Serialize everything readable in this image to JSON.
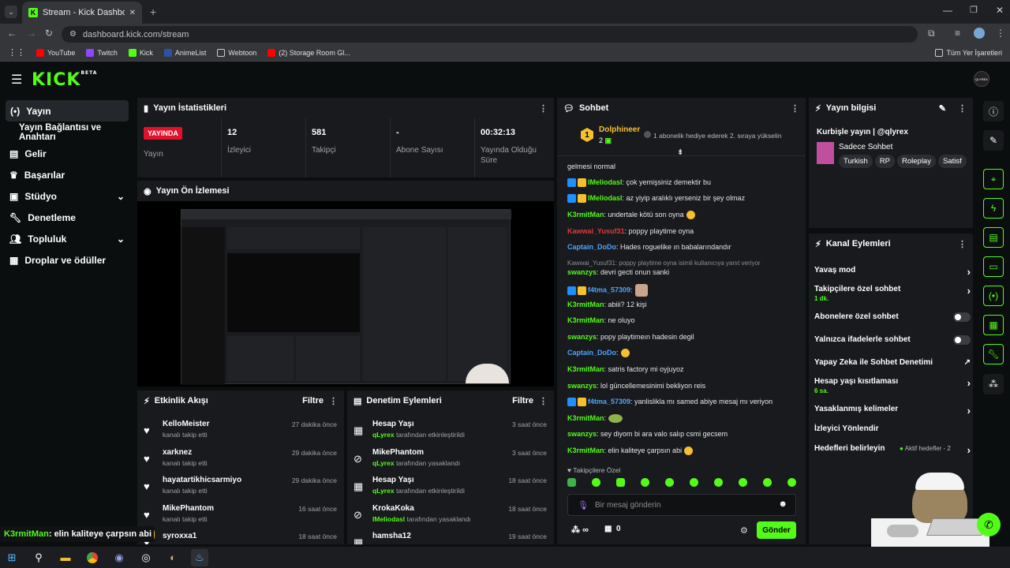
{
  "browser": {
    "tab_title": "Stream - Kick Dashboard",
    "url": "dashboard.kick.com/stream",
    "bookmarks": [
      "YouTube",
      "Twitch",
      "Kick",
      "AnimeList",
      "Webtoon",
      "(2) Storage Room Gl..."
    ],
    "bookmarks_right": "Tüm Yer İşaretleri"
  },
  "brand": {
    "logo": "KICK",
    "logo_sup": "BETA",
    "accent": "#53fc18",
    "avatar": "QLYREX"
  },
  "sidebar": {
    "items": [
      {
        "label": "Yayın"
      },
      {
        "label": "Yayın Bağlantısı ve Anahtarı"
      },
      {
        "label": "Gelir"
      },
      {
        "label": "Başarılar"
      },
      {
        "label": "Stüdyo"
      },
      {
        "label": "Denetleme"
      },
      {
        "label": "Topluluk"
      },
      {
        "label": "Droplar ve ödüller"
      }
    ]
  },
  "stats": {
    "title": "Yayın İstatistikleri",
    "live_badge": "YAYINDA",
    "live_label": "Yayın",
    "viewers": "12",
    "viewers_label": "İzleyici",
    "followers": "581",
    "followers_label": "Takipçi",
    "subs": "-",
    "subs_label": "Abone Sayısı",
    "duration": "00:32:13",
    "duration_label": "Yayında Olduğu Süre"
  },
  "preview": {
    "title": "Yayın Ön İzlemesi"
  },
  "activity": {
    "title": "Etkinlik Akışı",
    "filter": "Filtre",
    "items": [
      {
        "name": "KelloMeister",
        "sub": "kanalı takip etti",
        "time": "27 dakika önce"
      },
      {
        "name": "xarknez",
        "sub": "kanalı takip etti",
        "time": "29 dakika önce"
      },
      {
        "name": "hayatartikhicsarmiyo",
        "sub": "kanalı takip etti",
        "time": "29 dakika önce"
      },
      {
        "name": "MikePhantom",
        "sub": "kanalı takip etti",
        "time": "16 saat önce"
      },
      {
        "name": "syroxxa1",
        "sub": "",
        "time": "18 saat önce"
      }
    ]
  },
  "moderation": {
    "title": "Denetim Eylemleri",
    "filter": "Filtre",
    "items": [
      {
        "name": "Hesap Yaşı",
        "by": "qLyrex",
        "action": "tarafından etkinleştirildi",
        "time": "3 saat önce"
      },
      {
        "name": "MikePhantom",
        "by": "qLyrex",
        "action": "tarafından yasaklandı",
        "time": "3 saat önce"
      },
      {
        "name": "Hesap Yaşı",
        "by": "qLyrex",
        "action": "tarafından etkinleştirildi",
        "time": "18 saat önce"
      },
      {
        "name": "KrokaKoka",
        "by": "IMeliodasl",
        "action": "tarafından yasaklandı",
        "time": "18 saat önce"
      },
      {
        "name": "hamsha12",
        "by": "",
        "action": "",
        "time": "19 saat önce"
      }
    ]
  },
  "chat": {
    "title": "Sohbet",
    "pinned_user": "Dolphineer",
    "pinned_count": "2",
    "pinned_text": "1 abonelik hediye ederek 2. sıraya yükselin",
    "messages": [
      {
        "user": "",
        "text": "gelmesi normal",
        "color": "#ffffff"
      },
      {
        "user": "IMeliodasl",
        "text": ": çok yemişsiniz demektir bu",
        "color": "#53fc18"
      },
      {
        "user": "IMeliodasl",
        "text": ": az yiyip aralıklı yerseniz bir şey olmaz",
        "color": "#53fc18"
      },
      {
        "user": "K3rmitMan",
        "text": ": undertale kötü son oyna",
        "color": "#53fc18"
      },
      {
        "user": "Kawwai_Yusuf31",
        "text": ": poppy playtime oyna",
        "color": "#e23a3a"
      },
      {
        "user": "Captain_DoDo",
        "text": ": Hades roguelike ın babalarındandır",
        "color": "#4fa3ff"
      },
      {
        "user": "",
        "text": "Kawwai_Yusuf31: poppy playtime oyna isimli kullanıcıya yanıt veriyor",
        "color": "#8a8f94"
      },
      {
        "user": "swanzys",
        "text": ": devri gecti onun sanki",
        "color": "#53fc18"
      },
      {
        "user": "f4tma_57309",
        "text": ":",
        "color": "#4fa3ff"
      },
      {
        "user": "K3rmitMan",
        "text": ": abiii? 12 kişi",
        "color": "#53fc18"
      },
      {
        "user": "K3rmitMan",
        "text": ": ne oluyo",
        "color": "#53fc18"
      },
      {
        "user": "swanzys",
        "text": ": popy playtimeın hadesin degil",
        "color": "#53fc18"
      },
      {
        "user": "Captain_DoDo",
        "text": ":",
        "color": "#4fa3ff"
      },
      {
        "user": "K3rmitMan",
        "text": ": satris factory mi oyjuyoz",
        "color": "#53fc18"
      },
      {
        "user": "swanzys",
        "text": ": lol güncellemesinimi bekliyon reis",
        "color": "#53fc18"
      },
      {
        "user": "f4tma_57309",
        "text": ": yanlislikla mı samed abiye mesaj mı veriyon",
        "color": "#4fa3ff"
      },
      {
        "user": "K3rmitMan",
        "text": ":",
        "color": "#53fc18"
      },
      {
        "user": "swanzys",
        "text": ": sey diyom bi ara valo salıp csmi gecsem",
        "color": "#53fc18"
      },
      {
        "user": "K3rmitMan",
        "text": ": elin kaliteye çarpsın abi",
        "color": "#53fc18"
      }
    ],
    "followers_only": "Takipçilere Özel",
    "placeholder": "Bir mesaj gönderin",
    "points": "0",
    "send": "Gönder",
    "infinity": "∞"
  },
  "info": {
    "title": "Yayın bilgisi",
    "stream_title": "Kurbişle yayın | @qlyrex",
    "category": "Sadece Sohbet",
    "tags": [
      "Turkish",
      "RP",
      "Roleplay",
      "Satisf"
    ]
  },
  "channel_actions": {
    "title": "Kanal Eylemleri",
    "slow_mode": "Yavaş mod",
    "followers_chat": "Takipçilere özel sohbet",
    "followers_chat_sub": "1 dk.",
    "subs_chat": "Abonelere özel sohbet",
    "emote_chat": "Yalnızca ifadelerle sohbet",
    "ai_mod": "Yapay Zeka ile Sohbet Denetimi",
    "account_age": "Hesap yaşı kısıtlaması",
    "account_age_sub": "6 sa.",
    "banned_words": "Yasaklanmış kelimeler",
    "viewer_redirect": "İzleyici Yönlendir",
    "goals": "Hedefleri belirleyin",
    "goals_sub": "Aktif hedefler - 2"
  },
  "overlay_chat": {
    "user": "K3rmitMan",
    "text": " : elin kaliteye çarpsın abi"
  }
}
